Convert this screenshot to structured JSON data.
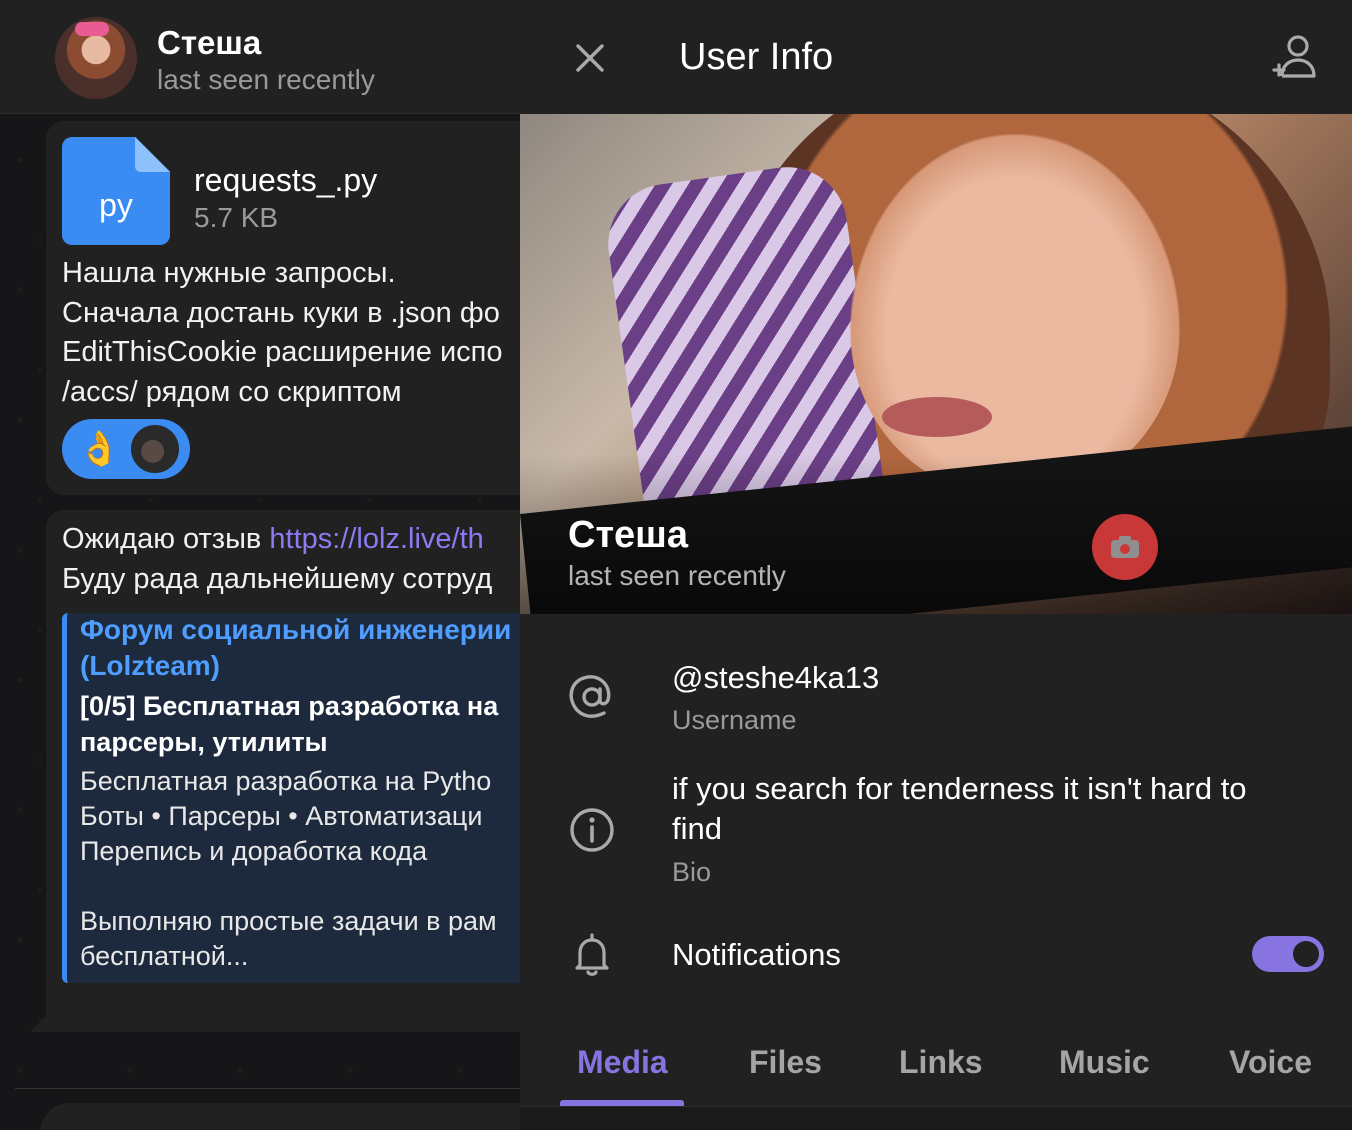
{
  "chat": {
    "header": {
      "name": "Стеша",
      "status": "last seen recently"
    },
    "file": {
      "ext": "py",
      "name": "requests_.py",
      "size": "5.7 KB"
    },
    "message1": "Нашла нужные запросы.\nСначала достань куки в .json фо\nEditThisCookie расширение испо\n/accs/ рядом со скриптом",
    "reaction": {
      "emoji": "👌"
    },
    "message2": {
      "line1_prefix": "Ожидаю отзыв ",
      "line1_link": "https://lolz.live/th",
      "line2": "Буду рада дальнейшему сотруд"
    },
    "preview": {
      "site": "Форум социальной инженерии\n(Lolzteam)",
      "title": "[0/5] Бесплатная разработка на\nпарсеры, утилиты",
      "description": "Бесплатная разработка на Pytho\nБоты • Парсеры • Автоматизаци\nПерепись и доработка кода",
      "description2": "Выполняю простые задачи в рам\nбесплатной..."
    }
  },
  "info": {
    "title": "User Info",
    "profile": {
      "name": "Стеша",
      "status": "last seen recently"
    },
    "username": {
      "value": "@steshe4ka13",
      "label": "Username"
    },
    "bio": {
      "value": "if you search for tenderness it isn't hard to\nfind",
      "label": "Bio"
    },
    "notifications": {
      "label": "Notifications",
      "enabled": true
    },
    "tabs": [
      {
        "label": "Media",
        "active": true
      },
      {
        "label": "Files",
        "active": false
      },
      {
        "label": "Links",
        "active": false
      },
      {
        "label": "Music",
        "active": false
      },
      {
        "label": "Voice",
        "active": false
      }
    ]
  },
  "colors": {
    "accent": "#8774e1",
    "file_blue": "#3b8cf2",
    "link_blue": "#4e9dff",
    "background": "#212121"
  },
  "icons": [
    "close-icon",
    "add-contact-icon",
    "camera-icon",
    "at-icon",
    "info-icon",
    "bell-icon",
    "file-icon"
  ]
}
